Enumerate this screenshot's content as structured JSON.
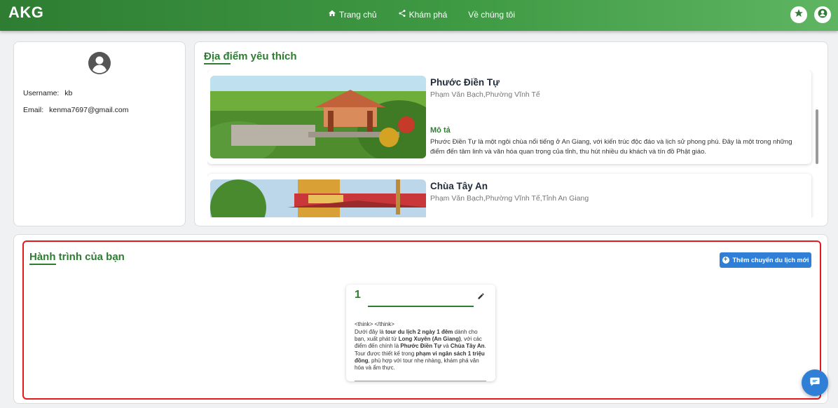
{
  "app": {
    "logo": "AKG"
  },
  "nav": {
    "items": [
      {
        "label": "Trang chủ",
        "icon": "home-icon"
      },
      {
        "label": "Khám phá",
        "icon": "share-icon"
      },
      {
        "label": "Về chúng tôi",
        "icon": ""
      }
    ],
    "right_icons": [
      "star-icon",
      "user-icon"
    ]
  },
  "profile": {
    "username_label": "Username:",
    "username": "kb",
    "email_label": "Email:",
    "email": "kenma7697@gmail.com"
  },
  "favorites": {
    "title": "Địa điểm yêu thích",
    "items": [
      {
        "name": "Phước Điền Tự",
        "address": "Phạm Văn Bạch,Phường Vĩnh Tế",
        "desc_title": "Mô tả",
        "desc": "Phước Điền Tự là một ngôi chùa nổi tiếng ở An Giang, với kiến trúc độc đáo và lịch sử phong phú. Đây là một trong những điểm đến tâm linh và văn hóa quan trọng của tỉnh, thu hút nhiều du khách và tín đồ Phật giáo."
      },
      {
        "name": "Chùa Tây An",
        "address": "Phạm Văn Bạch,Phường Vĩnh Tế,Tỉnh An Giang"
      }
    ]
  },
  "trips": {
    "title": "Hành trình của bạn",
    "add_button": "Thêm chuyến du lịch mới",
    "items": [
      {
        "number": "1",
        "think": "<think> </think>",
        "t1": "Dưới đây là ",
        "b1": "tour du lịch 2 ngày 1 đêm",
        "t2": " dành cho bạn, xuất phát từ ",
        "b2": "Long Xuyên (An Giang)",
        "t3": ", với các điểm đến chính là ",
        "b3": "Phước Điền Tự",
        "t4": " và ",
        "b4": "Chùa Tây An",
        "t5": ". Tour được thiết kế trong ",
        "b5": "phạm vi ngân sách 1 triệu đồng",
        "t6": ", phù hợp với tour nhẹ nhàng, khám phá văn hóa và ẩm thực."
      }
    ]
  },
  "colors": {
    "brand": "#2e7d32",
    "accent": "#2f7fd6",
    "highlight": "#e31b1b"
  }
}
